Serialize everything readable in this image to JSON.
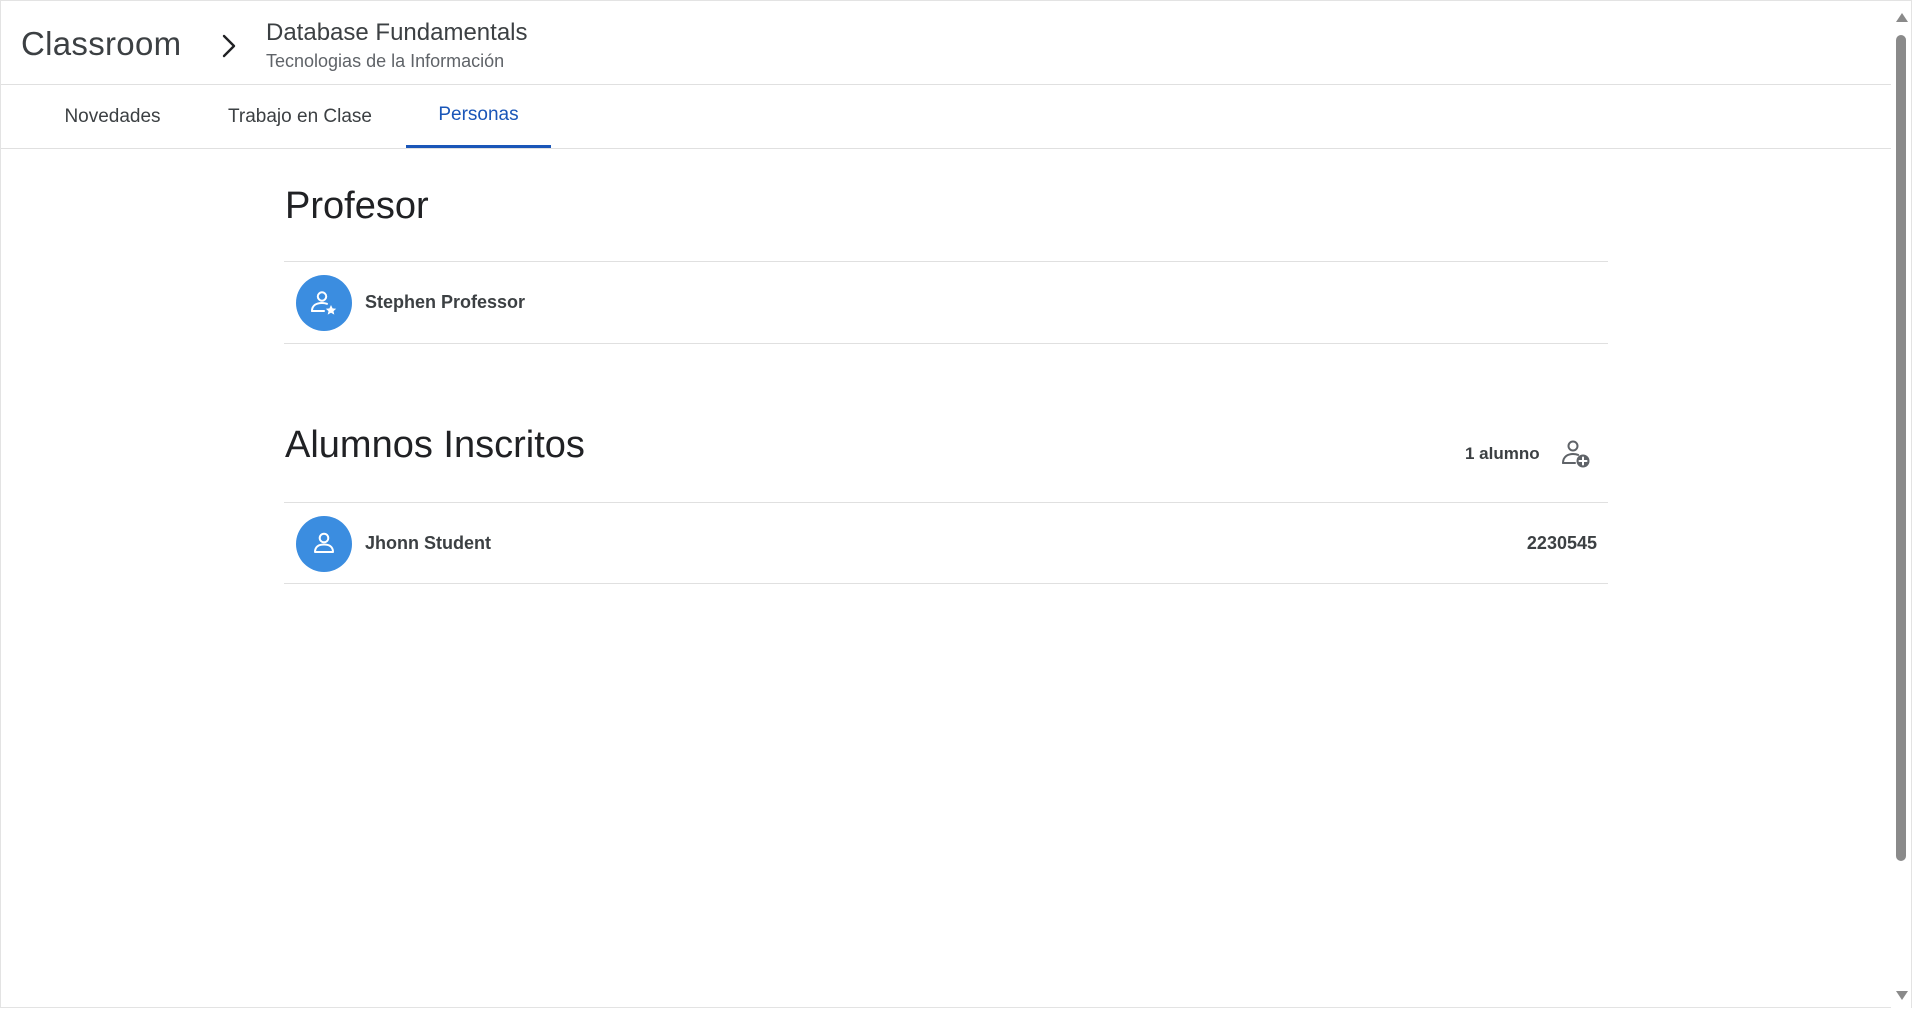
{
  "header": {
    "app_title": "Classroom",
    "course_name": "Database Fundamentals",
    "course_subtitle": "Tecnologias de la Información"
  },
  "tabs": [
    {
      "label": "Novedades",
      "active": false
    },
    {
      "label": "Trabajo en Clase",
      "active": false
    },
    {
      "label": "Personas",
      "active": true
    }
  ],
  "teachers": {
    "title": "Profesor",
    "people": [
      {
        "name": "Stephen Professor",
        "icon": "person-star-icon"
      }
    ]
  },
  "students": {
    "title": "Alumnos Inscritos",
    "count_label": "1 alumno",
    "add_icon": "person-add-icon",
    "people": [
      {
        "name": "Jhonn Student",
        "id": "2230545",
        "icon": "person-icon"
      }
    ]
  },
  "colors": {
    "accent": "#1a56b8",
    "avatar": "#3b8de0"
  }
}
